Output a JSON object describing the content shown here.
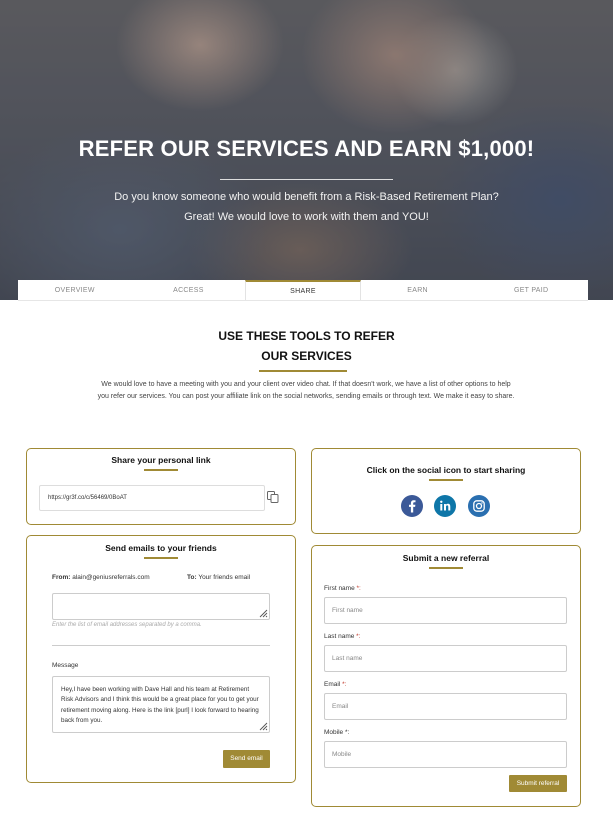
{
  "hero": {
    "title": "REFER OUR SERVICES AND EARN $1,000!",
    "line1": "Do you know someone who would benefit from a Risk-Based Retirement Plan?",
    "line2": "Great! We would love to work with them and YOU!"
  },
  "tabs": [
    {
      "label": "OVERVIEW",
      "active": false
    },
    {
      "label": "ACCESS",
      "active": false
    },
    {
      "label": "SHARE",
      "active": true
    },
    {
      "label": "EARN",
      "active": false
    },
    {
      "label": "GET PAID",
      "active": false
    }
  ],
  "section": {
    "title_line1": "USE THESE TOOLS TO REFER",
    "title_line2": "OUR SERVICES",
    "description": "We would love to have a meeting with you and your client over video chat. If that doesn't work, we have a list of other options to help you refer our services. You can post your affiliate link on the social networks, sending emails or through text. We make it easy to share."
  },
  "personal_link": {
    "title": "Share your personal link",
    "url": "https://gr3f.co/c/56469/0BoAT",
    "copy_icon": "copy-icon"
  },
  "social": {
    "title": "Click on the social icon to start sharing",
    "icons": [
      "facebook-icon",
      "linkedin-icon",
      "instagram-icon"
    ],
    "colors": {
      "facebook": "#3b5998",
      "linkedin": "#0e76a8",
      "instagram": "#2a6fb0"
    }
  },
  "emails": {
    "title": "Send emails to your friends",
    "from_label": "From:",
    "from_value": "alain@geniusreferrals.com",
    "to_label": "To:",
    "to_value": "Your friends email",
    "recipients_hint": "Enter the list of email addresses separated by a comma.",
    "message_label": "Message",
    "message": "Hey,I have been working with Dave Hall and his team at Retirement Risk Advisors and I think this would be a great place for you to get your retirement moving along. Here is the link [purl] I look forward to hearing back from you.",
    "send_label": "Send email"
  },
  "referral": {
    "title": "Submit a new referral",
    "fields": [
      {
        "label": "First name",
        "placeholder": "First name"
      },
      {
        "label": "Last name",
        "placeholder": "Last name"
      },
      {
        "label": "Email",
        "placeholder": "Email"
      },
      {
        "label": "Mobile",
        "placeholder": "Mobile"
      }
    ],
    "required_mark": "*:",
    "submit_label": "Submit referral"
  },
  "accent_color": "#a08a35"
}
